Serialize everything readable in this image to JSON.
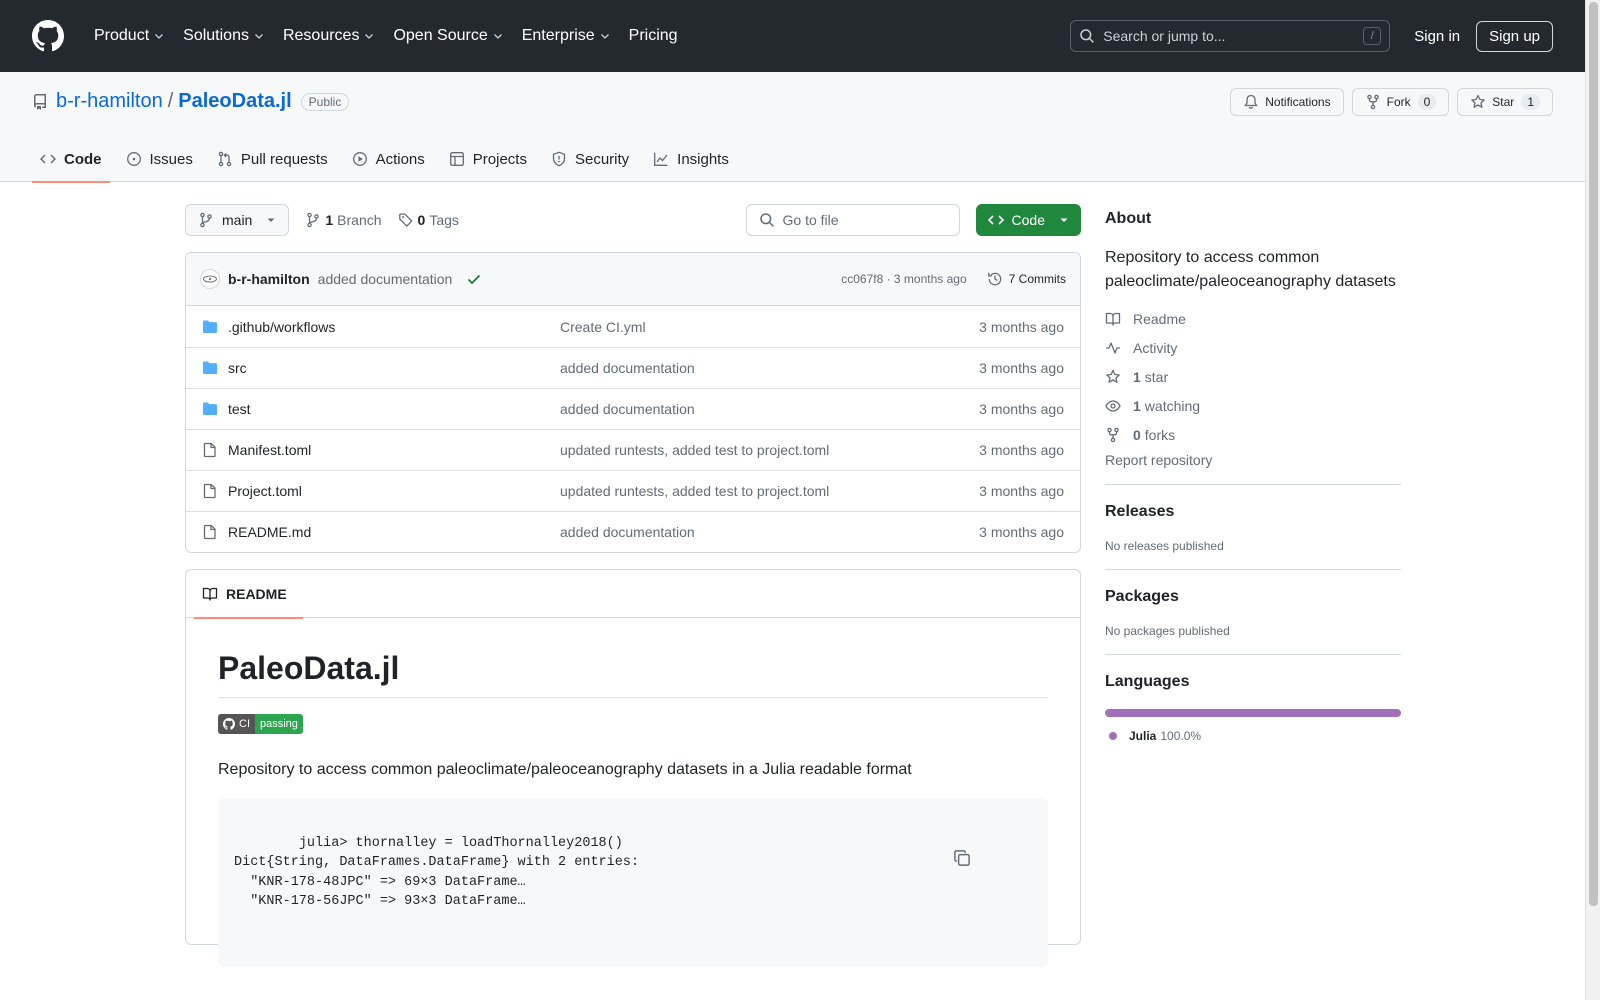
{
  "header": {
    "nav": [
      "Product",
      "Solutions",
      "Resources",
      "Open Source",
      "Enterprise",
      "Pricing"
    ],
    "search_placeholder": "Search or jump to...",
    "search_shortcut": "/",
    "sign_in": "Sign in",
    "sign_up": "Sign up"
  },
  "repo": {
    "owner": "b-r-hamilton",
    "separator": "/",
    "name": "PaleoData.jl",
    "visibility": "Public",
    "notifications_label": "Notifications",
    "fork_label": "Fork",
    "fork_count": "0",
    "star_label": "Star",
    "star_count": "1",
    "tabs": [
      "Code",
      "Issues",
      "Pull requests",
      "Actions",
      "Projects",
      "Security",
      "Insights"
    ]
  },
  "toolbar": {
    "branch": "main",
    "branch_count": "1",
    "branch_label": "Branch",
    "tag_count": "0",
    "tag_label": "Tags",
    "goto_placeholder": "Go to file",
    "code_label": "Code"
  },
  "commit": {
    "author": "b-r-hamilton",
    "message": "added documentation",
    "sha_and_time": "cc067f8 · 3 months ago",
    "commits_label": "7 Commits"
  },
  "files": [
    {
      "name": ".github/workflows",
      "type": "dir",
      "message": "Create CI.yml",
      "date": "3 months ago"
    },
    {
      "name": "src",
      "type": "dir",
      "message": "added documentation",
      "date": "3 months ago"
    },
    {
      "name": "test",
      "type": "dir",
      "message": "added documentation",
      "date": "3 months ago"
    },
    {
      "name": "Manifest.toml",
      "type": "file",
      "message": "updated runtests, added test to project.toml",
      "date": "3 months ago"
    },
    {
      "name": "Project.toml",
      "type": "file",
      "message": "updated runtests, added test to project.toml",
      "date": "3 months ago"
    },
    {
      "name": "README.md",
      "type": "file",
      "message": "added documentation",
      "date": "3 months ago"
    }
  ],
  "readme": {
    "tab_label": "README",
    "title": "PaleoData.jl",
    "badge_left": "CI",
    "badge_right": "passing",
    "description": "Repository to access common paleoclimate/paleoceanography datasets in a Julia readable format",
    "code": "julia> thornalley = loadThornalley2018()\nDict{String, DataFrames.DataFrame} with 2 entries:\n  \"KNR-178-48JPC\" => 69×3 DataFrame…\n  \"KNR-178-56JPC\" => 93×3 DataFrame…"
  },
  "sidebar": {
    "about_heading": "About",
    "about_text": "Repository to access common paleoclimate/paleoceanography datasets",
    "readme": "Readme",
    "activity": "Activity",
    "stars_count": "1",
    "stars_label": "star",
    "watching_count": "1",
    "watching_label": "watching",
    "forks_count": "0",
    "forks_label": "forks",
    "report": "Report repository",
    "releases_heading": "Releases",
    "releases_text": "No releases published",
    "packages_heading": "Packages",
    "packages_text": "No packages published",
    "languages_heading": "Languages",
    "language_name": "Julia",
    "language_pct": "100.0%",
    "language_color": "#a270ba"
  },
  "colors": {
    "header_bg": "#24292f",
    "accent": "#0969da",
    "code_button": "#1f883d",
    "tab_underline": "#fd8c73",
    "folder": "#54aeff"
  }
}
